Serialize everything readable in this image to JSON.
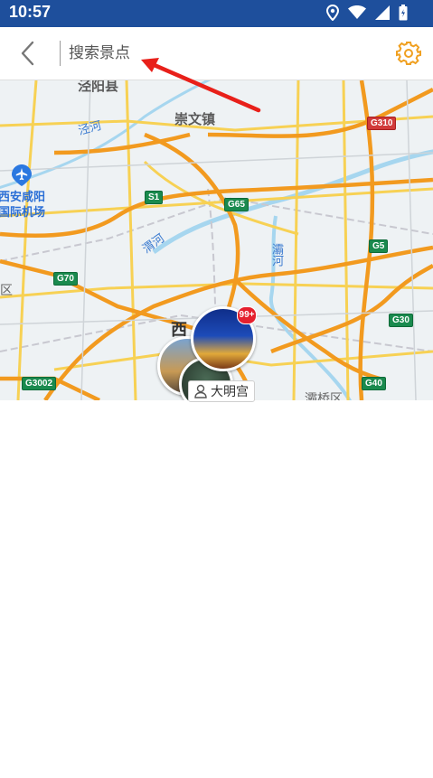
{
  "status_bar": {
    "time": "10:57",
    "icons": [
      "location-icon",
      "wifi-icon",
      "signal-icon",
      "battery-icon"
    ]
  },
  "toolbar": {
    "back_icon": "chevron-left-icon",
    "search_placeholder": "搜索景点",
    "settings_icon": "gear-icon",
    "accent_color": "#f0a020"
  },
  "map": {
    "towns": [
      "泾阳县",
      "崇文镇"
    ],
    "rivers": [
      "泾河",
      "渭河",
      "灞河"
    ],
    "airport": "西安咸阳国际机场",
    "district_left": "区",
    "district_bottom": "灞桥区",
    "city": "西",
    "highways": [
      "G310",
      "S1",
      "G65",
      "G5",
      "G70",
      "G30",
      "G3002",
      "G40"
    ],
    "marker_badge": "99+",
    "callout_label": "大明宫",
    "callout_icon": "person-icon"
  },
  "annotation": {
    "color": "#e8201a"
  }
}
